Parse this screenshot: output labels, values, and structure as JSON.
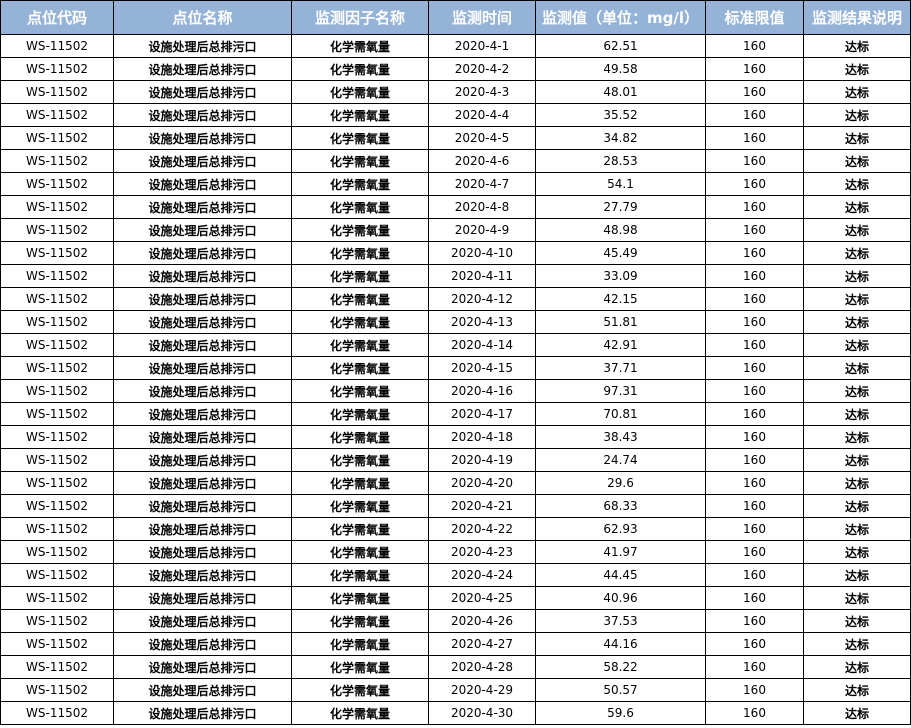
{
  "table": {
    "headers": [
      "点位代码",
      "点位名称",
      "监测因子名称",
      "监测时间",
      "监测值（单位：mg/l）",
      "标准限值",
      "监测结果说明"
    ],
    "rows": [
      [
        "WS-11502",
        "设施处理后总排污口",
        "化学需氧量",
        "2020-4-1",
        "62.51",
        "160",
        "达标"
      ],
      [
        "WS-11502",
        "设施处理后总排污口",
        "化学需氧量",
        "2020-4-2",
        "49.58",
        "160",
        "达标"
      ],
      [
        "WS-11502",
        "设施处理后总排污口",
        "化学需氧量",
        "2020-4-3",
        "48.01",
        "160",
        "达标"
      ],
      [
        "WS-11502",
        "设施处理后总排污口",
        "化学需氧量",
        "2020-4-4",
        "35.52",
        "160",
        "达标"
      ],
      [
        "WS-11502",
        "设施处理后总排污口",
        "化学需氧量",
        "2020-4-5",
        "34.82",
        "160",
        "达标"
      ],
      [
        "WS-11502",
        "设施处理后总排污口",
        "化学需氧量",
        "2020-4-6",
        "28.53",
        "160",
        "达标"
      ],
      [
        "WS-11502",
        "设施处理后总排污口",
        "化学需氧量",
        "2020-4-7",
        "54.1",
        "160",
        "达标"
      ],
      [
        "WS-11502",
        "设施处理后总排污口",
        "化学需氧量",
        "2020-4-8",
        "27.79",
        "160",
        "达标"
      ],
      [
        "WS-11502",
        "设施处理后总排污口",
        "化学需氧量",
        "2020-4-9",
        "48.98",
        "160",
        "达标"
      ],
      [
        "WS-11502",
        "设施处理后总排污口",
        "化学需氧量",
        "2020-4-10",
        "45.49",
        "160",
        "达标"
      ],
      [
        "WS-11502",
        "设施处理后总排污口",
        "化学需氧量",
        "2020-4-11",
        "33.09",
        "160",
        "达标"
      ],
      [
        "WS-11502",
        "设施处理后总排污口",
        "化学需氧量",
        "2020-4-12",
        "42.15",
        "160",
        "达标"
      ],
      [
        "WS-11502",
        "设施处理后总排污口",
        "化学需氧量",
        "2020-4-13",
        "51.81",
        "160",
        "达标"
      ],
      [
        "WS-11502",
        "设施处理后总排污口",
        "化学需氧量",
        "2020-4-14",
        "42.91",
        "160",
        "达标"
      ],
      [
        "WS-11502",
        "设施处理后总排污口",
        "化学需氧量",
        "2020-4-15",
        "37.71",
        "160",
        "达标"
      ],
      [
        "WS-11502",
        "设施处理后总排污口",
        "化学需氧量",
        "2020-4-16",
        "97.31",
        "160",
        "达标"
      ],
      [
        "WS-11502",
        "设施处理后总排污口",
        "化学需氧量",
        "2020-4-17",
        "70.81",
        "160",
        "达标"
      ],
      [
        "WS-11502",
        "设施处理后总排污口",
        "化学需氧量",
        "2020-4-18",
        "38.43",
        "160",
        "达标"
      ],
      [
        "WS-11502",
        "设施处理后总排污口",
        "化学需氧量",
        "2020-4-19",
        "24.74",
        "160",
        "达标"
      ],
      [
        "WS-11502",
        "设施处理后总排污口",
        "化学需氧量",
        "2020-4-20",
        "29.6",
        "160",
        "达标"
      ],
      [
        "WS-11502",
        "设施处理后总排污口",
        "化学需氧量",
        "2020-4-21",
        "68.33",
        "160",
        "达标"
      ],
      [
        "WS-11502",
        "设施处理后总排污口",
        "化学需氧量",
        "2020-4-22",
        "62.93",
        "160",
        "达标"
      ],
      [
        "WS-11502",
        "设施处理后总排污口",
        "化学需氧量",
        "2020-4-23",
        "41.97",
        "160",
        "达标"
      ],
      [
        "WS-11502",
        "设施处理后总排污口",
        "化学需氧量",
        "2020-4-24",
        "44.45",
        "160",
        "达标"
      ],
      [
        "WS-11502",
        "设施处理后总排污口",
        "化学需氧量",
        "2020-4-25",
        "40.96",
        "160",
        "达标"
      ],
      [
        "WS-11502",
        "设施处理后总排污口",
        "化学需氧量",
        "2020-4-26",
        "37.53",
        "160",
        "达标"
      ],
      [
        "WS-11502",
        "设施处理后总排污口",
        "化学需氧量",
        "2020-4-27",
        "44.16",
        "160",
        "达标"
      ],
      [
        "WS-11502",
        "设施处理后总排污口",
        "化学需氧量",
        "2020-4-28",
        "58.22",
        "160",
        "达标"
      ],
      [
        "WS-11502",
        "设施处理后总排污口",
        "化学需氧量",
        "2020-4-29",
        "50.57",
        "160",
        "达标"
      ],
      [
        "WS-11502",
        "设施处理后总排污口",
        "化学需氧量",
        "2020-4-30",
        "59.6",
        "160",
        "达标"
      ]
    ]
  },
  "colors": {
    "header_bg": "#95b3d7",
    "header_text": "#ffffff",
    "border": "#000000"
  }
}
